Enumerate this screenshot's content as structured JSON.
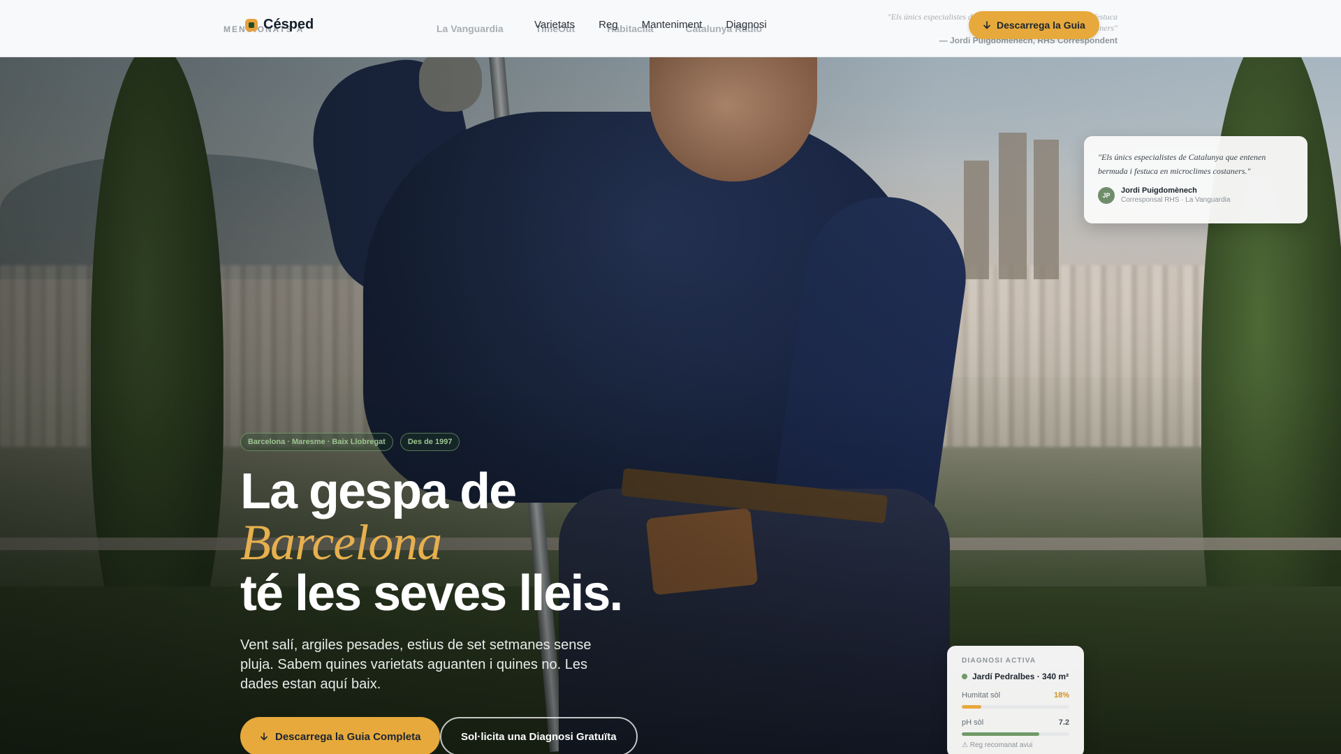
{
  "header": {
    "mentions_label": "MENCIONATS A",
    "mentions": [
      "La Vanguardia",
      "TimeOut",
      "Habitaclia",
      "Catalunya Ràdio"
    ],
    "logo_text": "Césped",
    "nav": [
      "Varietats",
      "Reg",
      "Manteniment",
      "Diagnosi"
    ],
    "quote": "\"Els únics especialistes de Catalunya que entenen bermuda i festuca en microclimes costaners\"",
    "quote_author": "— Jordi Puigdomènech, RHS Correspondent",
    "cta_label": "Descarrega la Guia"
  },
  "hero": {
    "chips": [
      "Barcelona · Maresme · Baix Llobregat",
      "Des de 1997"
    ],
    "title_line1": "La gespa de",
    "title_accent": "Barcelona",
    "title_line3": "té les seves lleis.",
    "lead": "Vent salí, argiles pesades, estius de set setmanes sense pluja. Sabem quines varietats aguanten i quines no. Les dades estan aquí baix.",
    "cta_primary": "Descarrega la Guia Completa",
    "cta_secondary": "Sol·licita una Diagnosi Gratuïta"
  },
  "testimonial": {
    "quote": "\"Els únics especialistes de Catalunya que entenen bermuda i festuca en microclimes costaners.\"",
    "initials": "JP",
    "name": "Jordi Puigdomènech",
    "role": "Corresponsal RHS · La Vanguardia"
  },
  "diagnosis": {
    "title": "DIAGNOSI ACTIVA",
    "site": "Jardí Pedralbes · 340 m²",
    "metrics": [
      {
        "label": "Humitat sòl",
        "value": "18%",
        "level": 0.18,
        "color": "#e7a93b"
      },
      {
        "label": "pH sòl",
        "value": "7.2",
        "level": 0.72,
        "color": "#6f9a66"
      }
    ],
    "note": "⚠ Reg recomanat avui"
  },
  "colors": {
    "accent": "#e7a93b",
    "brand_green": "#1e4d2b",
    "header_bg": "#f8f9fa"
  },
  "icons": {
    "download": "arrow-down-icon"
  }
}
